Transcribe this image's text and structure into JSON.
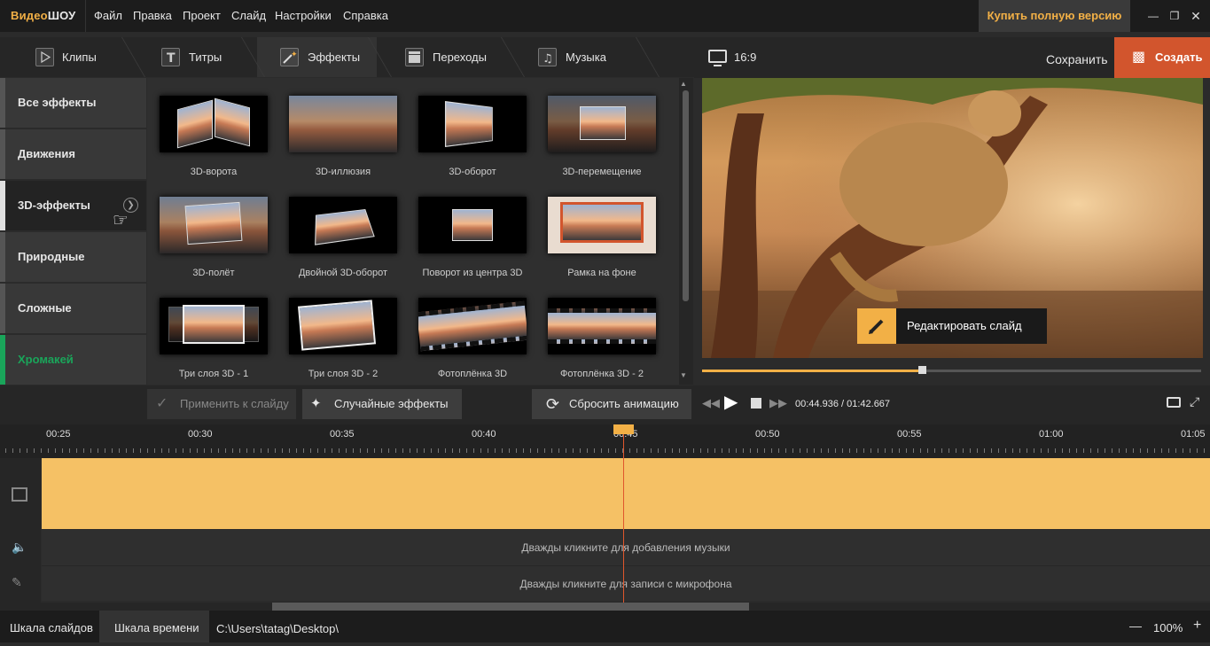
{
  "app": {
    "logo_part1": "Видео",
    "logo_part2": "ШОУ"
  },
  "menu": [
    "Файл",
    "Правка",
    "Проект",
    "Слайд",
    "Настройки",
    "Справка"
  ],
  "buy_label": "Купить полную версию",
  "tabs": [
    {
      "label": "Клипы",
      "icon": "play-icon"
    },
    {
      "label": "Титры",
      "icon": "text-icon"
    },
    {
      "label": "Эффекты",
      "icon": "magic-wand-icon"
    },
    {
      "label": "Переходы",
      "icon": "clapper-icon"
    },
    {
      "label": "Музыка",
      "icon": "music-icon"
    }
  ],
  "categories": [
    "Все эффекты",
    "Движения",
    "3D-эффекты",
    "Природные",
    "Сложные",
    "Хромакей"
  ],
  "effects": [
    "3D-ворота",
    "3D-иллюзия",
    "3D-оборот",
    "3D-перемещение",
    "3D-полёт",
    "Двойной 3D-оборот",
    "Поворот из центра 3D",
    "Рамка на фоне",
    "Три слоя 3D - 1",
    "Три слоя 3D - 2",
    "Фотоплёнка 3D",
    "Фотоплёнка 3D - 2"
  ],
  "buttons": {
    "apply": "Применить к слайду",
    "random": "Случайные эффекты",
    "reset": "Сбросить анимацию"
  },
  "preview": {
    "aspect": "16:9",
    "save": "Сохранить",
    "create": "Создать",
    "edit_slide": "Редактировать слайд",
    "time_current": "00:44.936",
    "time_total": "01:42.667",
    "progress": 0.44
  },
  "timeline": {
    "ticks": [
      "00:25",
      "00:30",
      "00:35",
      "00:40",
      "00:45",
      "00:50",
      "00:55",
      "01:00",
      "01:05"
    ],
    "music_hint": "Дважды кликните для добавления музыки",
    "mic_hint": "Дважды кликните для записи с микрофона"
  },
  "status": {
    "tab_slides": "Шкала слайдов",
    "tab_timeline": "Шкала времени",
    "path": "C:\\Users\\tatag\\Desktop\\",
    "zoom": "100%"
  },
  "colors": {
    "accent": "#f2b046",
    "create": "#d2552d",
    "chromakey": "#1aa55a",
    "track": "#f5c165"
  }
}
